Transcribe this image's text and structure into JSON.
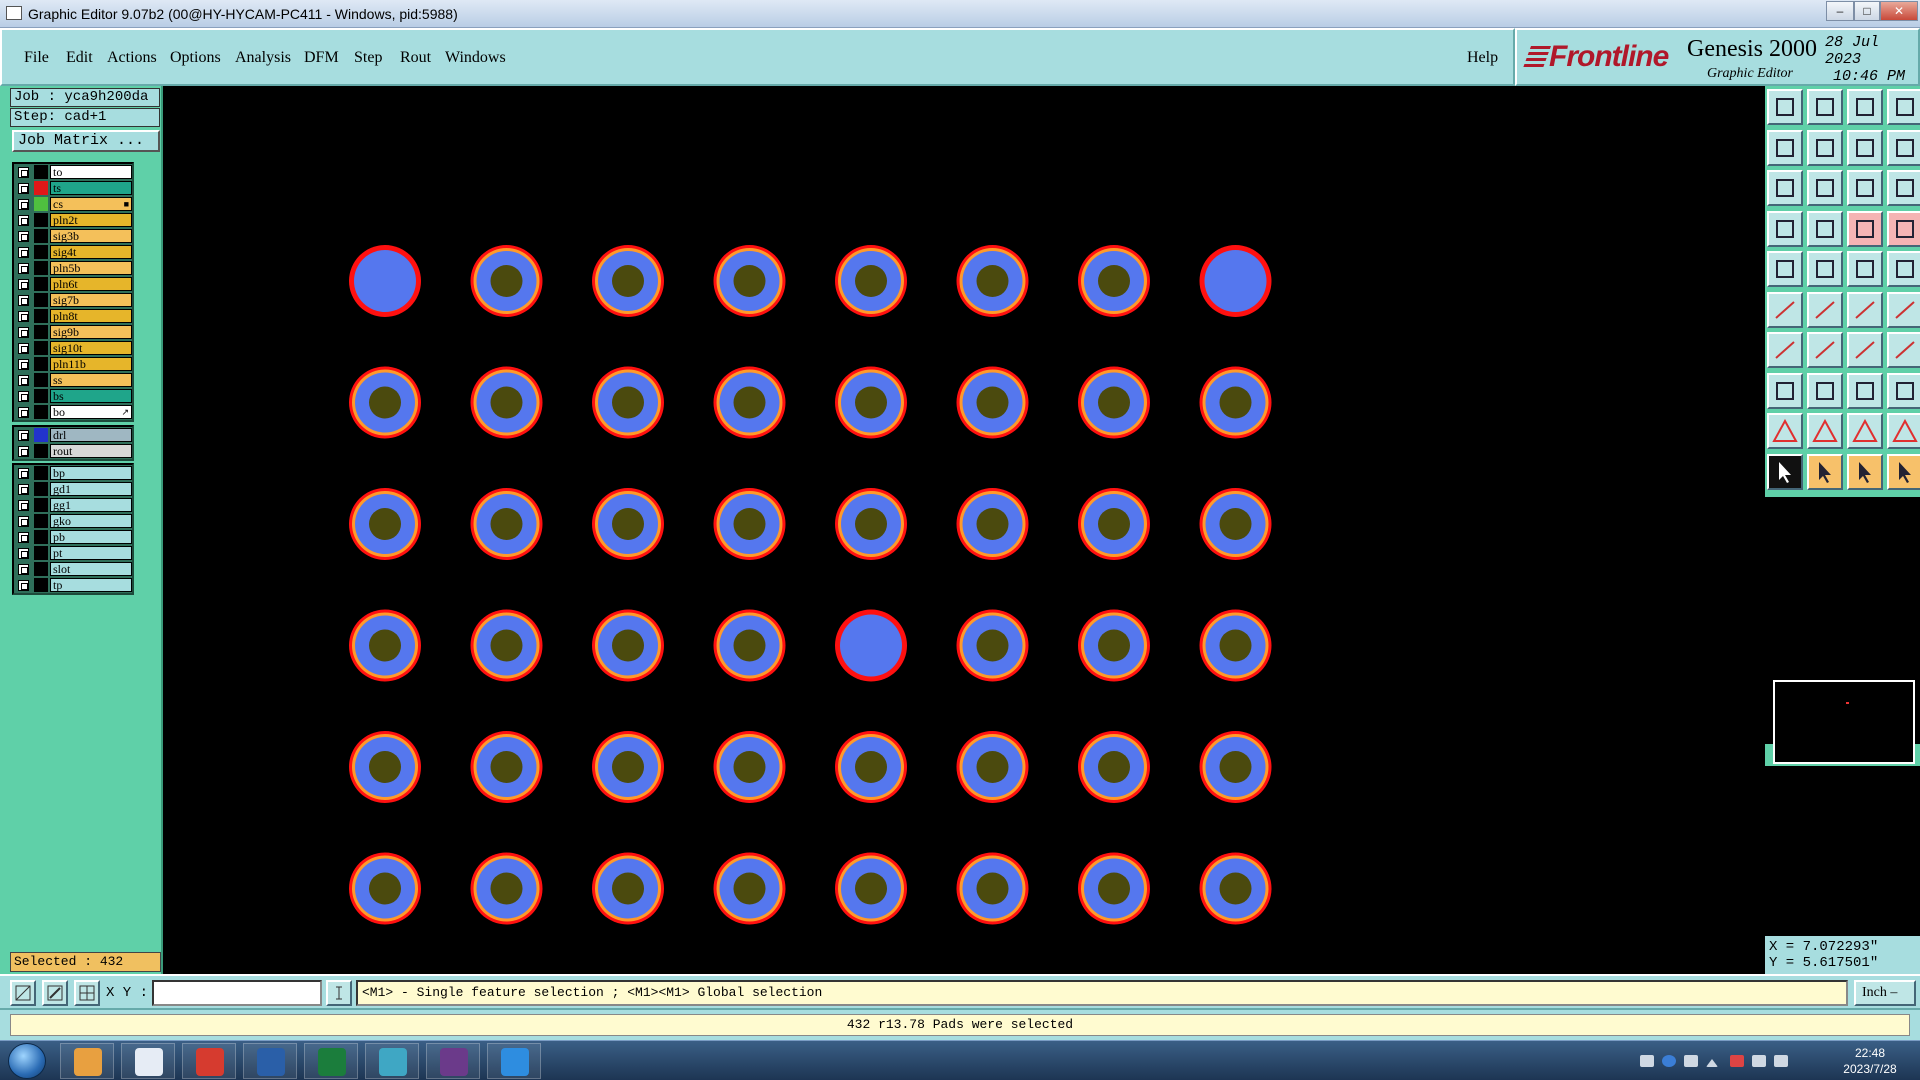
{
  "window": {
    "title": "Graphic Editor 9.07b2 (00@HY-HYCAM-PC411 - Windows, pid:5988)",
    "minimize": "–",
    "maximize": "□",
    "close": "✕"
  },
  "menu": [
    "File",
    "Edit",
    "Actions",
    "Options",
    "Analysis",
    "DFM",
    "Step",
    "Rout",
    "Windows"
  ],
  "help_label": "Help",
  "brand": {
    "logo": "Frontline",
    "product": "Genesis 2000",
    "subtitle": "Graphic Editor",
    "date": "28 Jul 2023",
    "time": "10:46 PM"
  },
  "job": {
    "job_label": "Job : yca9h200da",
    "step_label": "Step: cad+1",
    "matrix_button": "Job Matrix ..."
  },
  "layers": {
    "group1": [
      {
        "name": "to",
        "color": "#ffffff",
        "swatch": "#000000",
        "mark": ""
      },
      {
        "name": "ts",
        "color": "#1fa58a",
        "swatch": "#e01818",
        "mark": ""
      },
      {
        "name": "cs",
        "color": "#f4c05a",
        "swatch": "#4fbf3f",
        "mark": "■",
        "active": true
      },
      {
        "name": "pln2t",
        "color": "#e6b52a",
        "swatch": "#000000",
        "mark": ""
      },
      {
        "name": "sig3b",
        "color": "#f4c05a",
        "swatch": "#000000",
        "mark": ""
      },
      {
        "name": "sig4t",
        "color": "#e6b52a",
        "swatch": "#000000",
        "mark": ""
      },
      {
        "name": "pln5b",
        "color": "#f4c05a",
        "swatch": "#000000",
        "mark": ""
      },
      {
        "name": "pln6t",
        "color": "#e6b52a",
        "swatch": "#000000",
        "mark": ""
      },
      {
        "name": "sig7b",
        "color": "#f4c05a",
        "swatch": "#000000",
        "mark": ""
      },
      {
        "name": "pln8t",
        "color": "#e6b52a",
        "swatch": "#000000",
        "mark": ""
      },
      {
        "name": "sig9b",
        "color": "#f4c05a",
        "swatch": "#000000",
        "mark": ""
      },
      {
        "name": "sig10t",
        "color": "#e6b52a",
        "swatch": "#000000",
        "mark": ""
      },
      {
        "name": "pln11b",
        "color": "#e6b52a",
        "swatch": "#000000",
        "mark": ""
      },
      {
        "name": "ss",
        "color": "#f4c05a",
        "swatch": "#000000",
        "mark": ""
      },
      {
        "name": "bs",
        "color": "#1fa58a",
        "swatch": "#000000",
        "mark": ""
      },
      {
        "name": "bo",
        "color": "#ffffff",
        "swatch": "#000000",
        "mark": "↗"
      }
    ],
    "group2": [
      {
        "name": "drl",
        "color": "#9fb7c2",
        "swatch": "#2233cc",
        "mark": ""
      },
      {
        "name": "rout",
        "color": "#d8d8d8",
        "swatch": "#000000",
        "mark": ""
      }
    ],
    "group3": [
      {
        "name": "bp",
        "color": "#a7dddf",
        "swatch": "#000000",
        "mark": ""
      },
      {
        "name": "gd1",
        "color": "#a7dddf",
        "swatch": "#000000",
        "mark": ""
      },
      {
        "name": "gg1",
        "color": "#a7dddf",
        "swatch": "#000000",
        "mark": ""
      },
      {
        "name": "gko",
        "color": "#a7dddf",
        "swatch": "#000000",
        "mark": ""
      },
      {
        "name": "pb",
        "color": "#a7dddf",
        "swatch": "#000000",
        "mark": ""
      },
      {
        "name": "pt",
        "color": "#a7dddf",
        "swatch": "#000000",
        "mark": ""
      },
      {
        "name": "slot",
        "color": "#a7dddf",
        "swatch": "#000000",
        "mark": ""
      },
      {
        "name": "tp",
        "color": "#a7dddf",
        "swatch": "#000000",
        "mark": ""
      }
    ]
  },
  "selected_label": "Selected : 432",
  "pads": {
    "columns": 8,
    "rows": 6,
    "drilled_color": "#4b4a0e",
    "pad_color": "#5577ee",
    "ring_outer": "#ff1010",
    "ring_inner": "#ff9a2a",
    "undrilled": [
      [
        0,
        0
      ],
      [
        0,
        7
      ],
      [
        3,
        4
      ]
    ]
  },
  "toolbar_icons": [
    "home-icon",
    "save-icon",
    "home-tree-icon",
    "panel-icon",
    "step-left-icon",
    "step-right-icon",
    "split-icon",
    "table-icon",
    "zoom-fit-icon",
    "pan-icon",
    "scale-1to2-icon",
    "help-icon",
    "list-icon",
    "grid-icon",
    "measure-icon",
    "snap-icon",
    "select-dot-icon",
    "shape-icon",
    "layer-bar-icon",
    "pad-icon",
    "connect-icon",
    "cross-icon",
    "node-icon",
    "route-icon",
    "line-icon",
    "draw-icon",
    "arc-icon",
    "ruler-icon",
    "move-icon",
    "minus-icon",
    "resize-icon",
    "copy-icon",
    "triangle-icon",
    "triangle-a-icon",
    "triangle-b-icon",
    "triangle-c-icon",
    "pointer-icon",
    "pointer-select-icon",
    "pointer-area-icon",
    "pointer-route-icon"
  ],
  "coords": {
    "x": "X = 7.072293\"",
    "y": "Y = 5.617501\""
  },
  "prompt": {
    "xy_label": "X Y :",
    "xy_value": "",
    "help": "<M1> - Single feature selection ; <M1><M1> Global selection",
    "units": "Inch –"
  },
  "status": "432 r13.78 Pads were selected",
  "taskbar": {
    "apps": [
      "shell-app",
      "notepad-app",
      "redo-app",
      "floppy-app",
      "p-app",
      "eye-app",
      "x-app",
      "arrow-app"
    ],
    "time": "22:48",
    "date": "2023/7/28"
  }
}
